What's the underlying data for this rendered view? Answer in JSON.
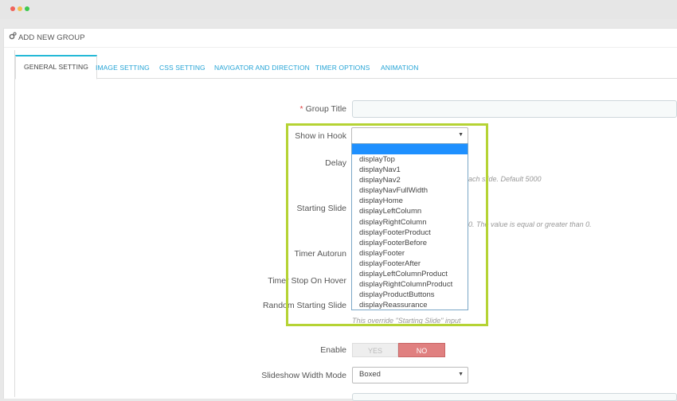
{
  "panel": {
    "title": "ADD NEW GROUP"
  },
  "tabs": [
    {
      "label": "GENERAL SETTING"
    },
    {
      "label": "IMAGE SETTING"
    },
    {
      "label": "CSS SETTING"
    },
    {
      "label": "NAVIGATOR AND DIRECTION"
    },
    {
      "label": "TIMER OPTIONS"
    },
    {
      "label": "ANIMATION"
    }
  ],
  "form": {
    "group_title": {
      "required_mark": "*",
      "label": "Group Title",
      "value": ""
    },
    "show_in_hook": {
      "label": "Show in Hook",
      "value": ""
    },
    "delay": {
      "label": "Delay",
      "help_fragment": "ach slide. Default 5000"
    },
    "starting_slide": {
      "label": "Starting Slide",
      "help_fragment": "0. The value is equal or greater than 0."
    },
    "timer_autorun": {
      "label": "Timer Autorun"
    },
    "timer_stop_on_hover": {
      "label": "Timer Stop On Hover"
    },
    "random_starting_slide": {
      "label": "Random Starting Slide",
      "help": "This override \"Starting Slide\" input"
    },
    "enable": {
      "label": "Enable",
      "yes": "YES",
      "no": "NO",
      "value": "NO"
    },
    "slideshow_width_mode": {
      "label": "Slideshow Width Mode",
      "value": "Boxed"
    }
  },
  "hook_options": [
    "displayTop",
    "displayNav1",
    "displayNav2",
    "displayNavFullWidth",
    "displayHome",
    "displayLeftColumn",
    "displayRightColumn",
    "displayFooterProduct",
    "displayFooterBefore",
    "displayFooter",
    "displayFooterAfter",
    "displayLeftColumnProduct",
    "displayRightColumnProduct",
    "displayProductButtons",
    "displayReassurance"
  ],
  "colors": {
    "accent": "#25b9d7",
    "link": "#25a4d6",
    "highlight": "#b5d334",
    "no_active": "#e08080",
    "dropdown_selected": "#1e90ff"
  }
}
